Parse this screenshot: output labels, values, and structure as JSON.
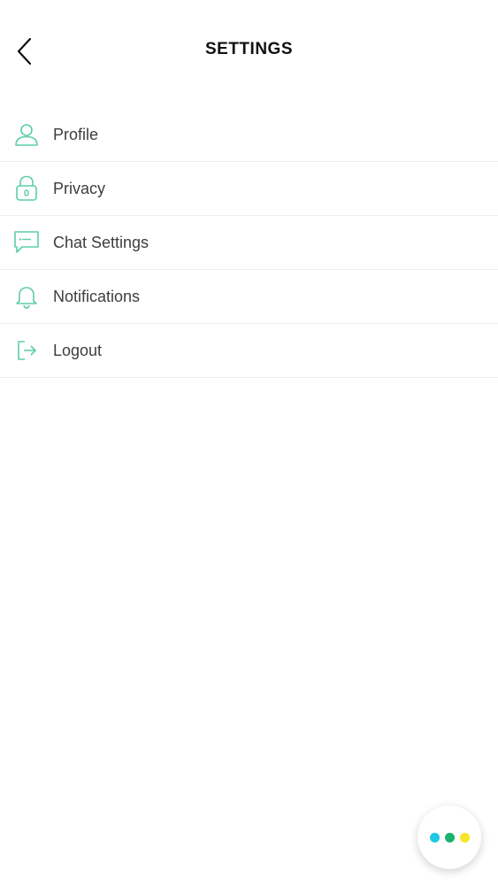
{
  "header": {
    "title": "SETTINGS",
    "back_icon": "chevron-left-icon"
  },
  "menu": {
    "accent_color": "#5ccfa3",
    "items": [
      {
        "label": "Profile",
        "icon": "user-icon"
      },
      {
        "label": "Privacy",
        "icon": "lock-icon"
      },
      {
        "label": "Chat Settings",
        "icon": "chat-bubble-icon"
      },
      {
        "label": "Notifications",
        "icon": "bell-icon"
      },
      {
        "label": "Logout",
        "icon": "logout-icon"
      }
    ]
  },
  "fab": {
    "icon": "more-dots-icon",
    "dot_colors": [
      "#1ec8e6",
      "#1bb36b",
      "#f5e62a"
    ]
  }
}
